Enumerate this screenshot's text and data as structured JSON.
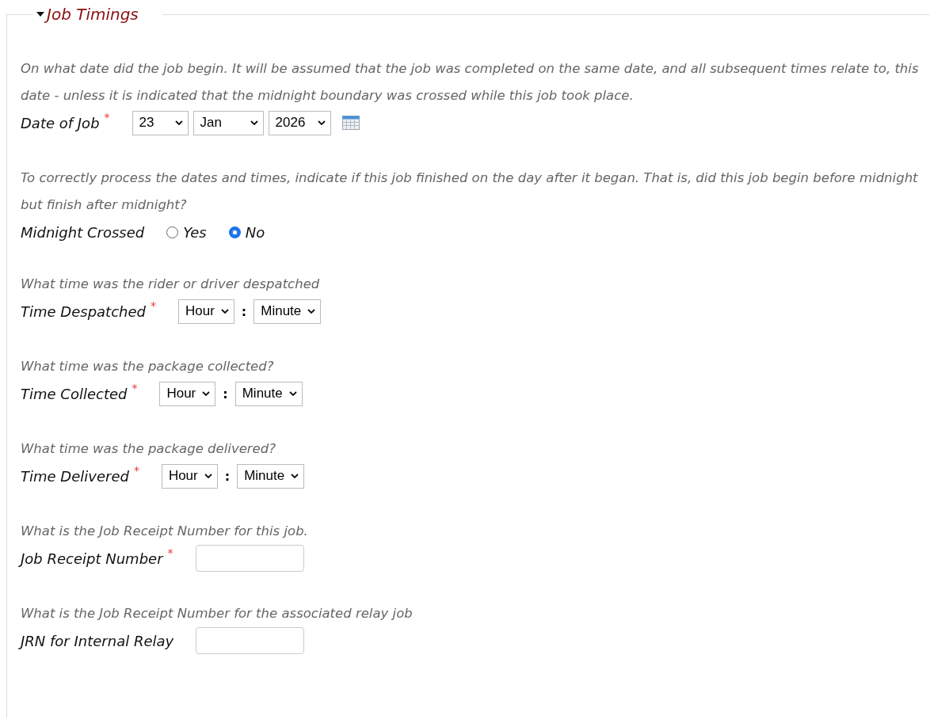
{
  "section": {
    "title": "Job Timings",
    "expanded": true
  },
  "questions": [
    {
      "kind": "date",
      "hint": "On what date did the job begin. It will be assumed that the job was completed on the same date, and all subsequent times relate to, this date - unless it is indicated that the midnight boundary was crossed while this job took place.",
      "label": "Date of Job",
      "required_mark": "*",
      "selects": [
        "23",
        "Jan",
        "2026"
      ]
    },
    {
      "kind": "radio",
      "hint": "To correctly process the dates and times, indicate if this job finished on the day after it began. That is, did this job begin before midnight but finish after midnight?",
      "label": "Midnight Crossed",
      "options": [
        {
          "label": "Yes",
          "selected": false
        },
        {
          "label": "No",
          "selected": true
        }
      ]
    },
    {
      "kind": "time",
      "hint": "What time was the rider or driver despatched",
      "label": "Time Despatched",
      "required_mark": "*",
      "hour": "Hour",
      "separator": ":",
      "minute": "Minute"
    },
    {
      "kind": "time",
      "hint": "What time was the package collected?",
      "label": "Time Collected",
      "required_mark": "*",
      "hour": "Hour",
      "separator": ":",
      "minute": "Minute"
    },
    {
      "kind": "time",
      "hint": "What time was the package delivered?",
      "label": "Time Delivered",
      "required_mark": "*",
      "hour": "Hour",
      "separator": ":",
      "minute": "Minute"
    },
    {
      "kind": "text",
      "hint": "What is the Job Receipt Number for this job.",
      "label": "Job Receipt Number",
      "required_mark": "*"
    },
    {
      "kind": "text",
      "hint": "What is the Job Receipt Number for the associated relay job",
      "label": "JRN for Internal Relay"
    }
  ]
}
